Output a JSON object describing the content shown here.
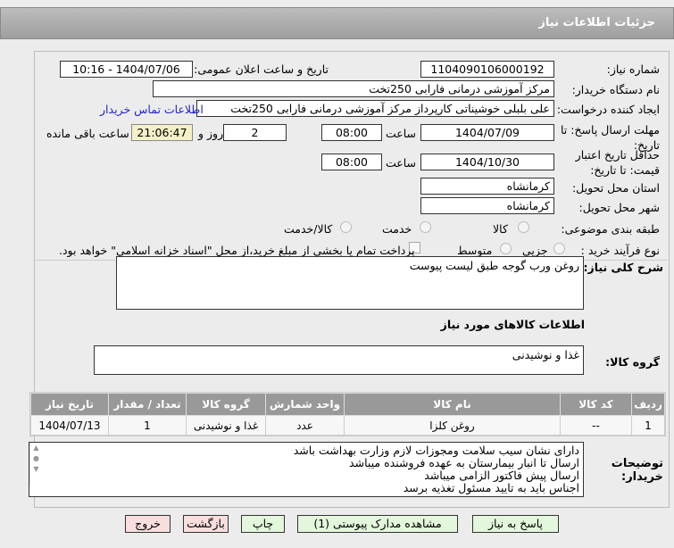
{
  "title": "جزئیات اطلاعات نیاز",
  "fields": {
    "need_number_label": "شماره نیاز:",
    "need_number": "1104090106000192",
    "announce_label": "تاریخ و ساعت اعلان عمومی:",
    "announce": "1404/07/06 - 10:16",
    "buyer_org_label": "نام دستگاه خریدار:",
    "buyer_org": "مرکز آموزشی  درمانی فارابی 250تخت",
    "creator_label": "ایجاد کننده درخواست:",
    "creator": "علی بلبلی خوشیناتی کارپرداز مرکز آموزشی  درمانی فارابی 250تخت",
    "contact_link": "اطلاعات تماس خریدار",
    "deadline_label": "مهلت ارسال پاسخ: تا تاریخ:",
    "deadline_date": "1404/07/09",
    "time_label": "ساعت",
    "deadline_time": "08:00",
    "days": "2",
    "days_label": "روز و",
    "remaining": "21:06:47",
    "remaining_label": "ساعت باقی مانده",
    "validity_label": "حداقل تاریخ اعتبار قیمت: تا تاریخ:",
    "validity_date": "1404/10/30",
    "validity_time": "08:00",
    "province_label": "استان محل تحویل:",
    "province": "کرمانشاه",
    "city_label": "شهر محل تحویل:",
    "city": "کرمانشاه",
    "category_label": "طبقه بندی موضوعی:",
    "category_options": [
      "کالا",
      "خدمت",
      "کالا/خدمت"
    ],
    "process_label": "نوع فرآیند خرید :",
    "process_options": [
      "جزیی",
      "متوسط"
    ],
    "payment_note": "پرداخت تمام یا بخشی از مبلغ خرید،از محل \"اسناد خزانه اسلامی\" خواهد بود."
  },
  "summary_label": "شرح کلی نیاز:",
  "summary": "روغن ورب گوجه طبق لیست پیوست",
  "goods_heading": "اطلاعات کالاهای مورد نیاز",
  "goods_group_label": "گروه کالا:",
  "goods_group": "غذا و نوشیدنی",
  "table": {
    "headers": [
      "ردیف",
      "کد کالا",
      "نام کالا",
      "واحد شمارش",
      "گروه کالا",
      "تعداد / مقدار",
      "تاریخ نیاز"
    ],
    "rows": [
      [
        "1",
        "--",
        "روغن کلزا",
        "عدد",
        "غذا و نوشیدنی",
        "1",
        "1404/07/13"
      ]
    ]
  },
  "notes_label": "توضیحات خریدار:",
  "notes": [
    "دارای نشان سیب سلامت ومجوزات لازم وزارت بهداشت  باشد",
    "ارسال تا انبار بیمارستان به عهده فروشنده میباشد",
    "ارسال پیش فاکتور الزامی میباشد",
    "اجناس باید به تایید مسئول تغذیه برسد"
  ],
  "buttons": {
    "reply": "پاسخ به نیاز",
    "docs": "مشاهده مدارک پیوستی (1)",
    "print": "چاپ",
    "back": "بازگشت",
    "exit": "خروج"
  }
}
